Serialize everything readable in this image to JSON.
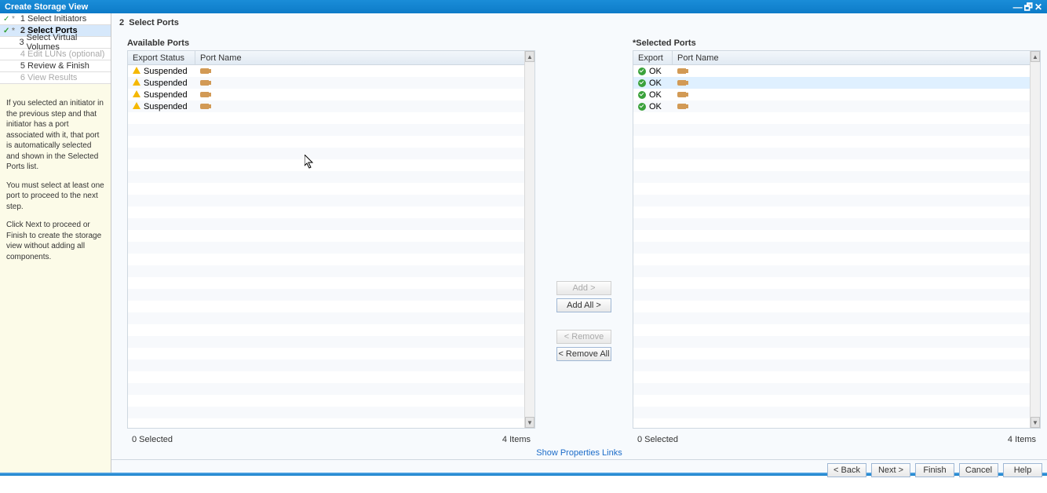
{
  "window": {
    "title": "Create Storage View"
  },
  "steps": [
    {
      "num": "1",
      "label": "Select Initiators",
      "checked": true,
      "star": true,
      "current": false,
      "disabled": false
    },
    {
      "num": "2",
      "label": "Select Ports",
      "checked": true,
      "star": true,
      "current": true,
      "disabled": false
    },
    {
      "num": "3",
      "label": "Select Virtual Volumes",
      "checked": false,
      "star": false,
      "current": false,
      "disabled": false
    },
    {
      "num": "4",
      "label": "Edit LUNs (optional)",
      "checked": false,
      "star": false,
      "current": false,
      "disabled": true
    },
    {
      "num": "5",
      "label": "Review & Finish",
      "checked": false,
      "star": false,
      "current": false,
      "disabled": false
    },
    {
      "num": "6",
      "label": "View Results",
      "checked": false,
      "star": false,
      "current": false,
      "disabled": true
    }
  ],
  "help": {
    "p1": "If you selected an initiator in the previous step and that initiator has a port associated with it, that port is automatically selected and shown in the Selected Ports list.",
    "p2": "You must select at least one port to proceed to the next step.",
    "p3": "Click Next to proceed or Finish to create the storage view without adding all components."
  },
  "header": {
    "step_num": "2",
    "step_label": "Select Ports"
  },
  "available": {
    "title": "Available Ports",
    "cols": {
      "status": "Export Status",
      "port": "Port Name"
    },
    "rows": [
      {
        "status": "Suspended"
      },
      {
        "status": "Suspended"
      },
      {
        "status": "Suspended"
      },
      {
        "status": "Suspended"
      }
    ],
    "selected_text": "0 Selected",
    "count_text": "4 Items"
  },
  "selected": {
    "title": "*Selected Ports",
    "cols": {
      "export": "Export",
      "port": "Port Name"
    },
    "rows": [
      {
        "status": "OK",
        "highlight": false
      },
      {
        "status": "OK",
        "highlight": true
      },
      {
        "status": "OK",
        "highlight": false
      },
      {
        "status": "OK",
        "highlight": false
      }
    ],
    "selected_text": "0 Selected",
    "count_text": "4 Items"
  },
  "mid": {
    "add": "Add >",
    "add_all": "Add All >",
    "remove": "< Remove",
    "remove_all": "< Remove All"
  },
  "props_link": "Show Properties Links",
  "footer": {
    "back": "< Back",
    "next": "Next >",
    "finish": "Finish",
    "cancel": "Cancel",
    "help": "Help"
  }
}
